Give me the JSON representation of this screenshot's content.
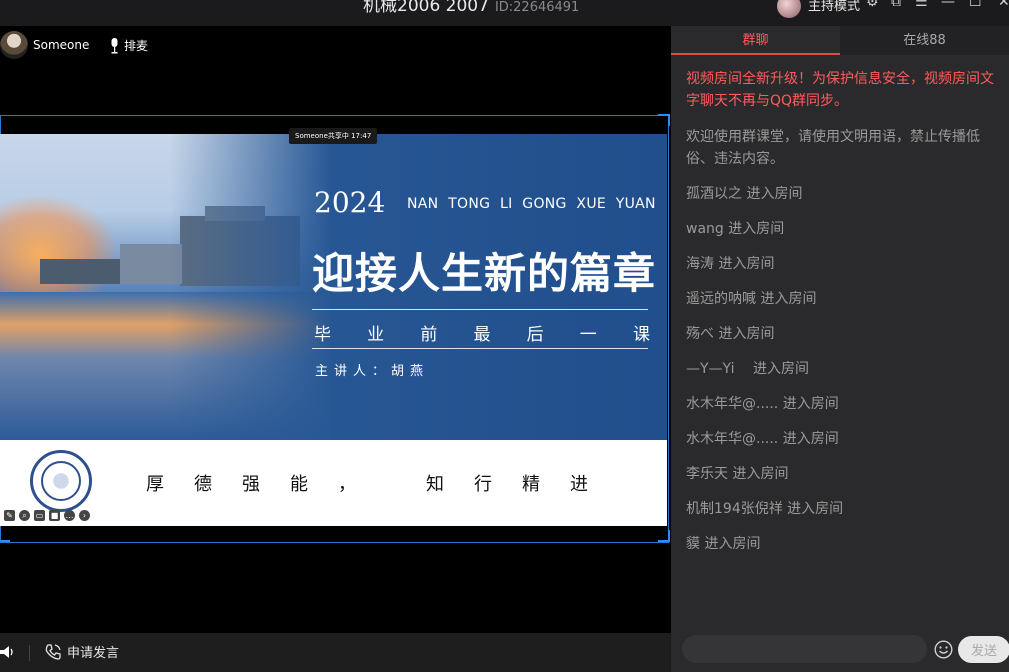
{
  "window": {
    "title": "机械2006 2007",
    "room_id": "ID:22646491",
    "host_mode_label": "主持模式"
  },
  "presenter": {
    "name": "Someone",
    "mic_label": "排麦",
    "share_tag": "Someone共享中 17:47"
  },
  "slide": {
    "year": "2024",
    "school_en": "NAN TONG LI GONG XUE YUAN",
    "headline": "迎接人生新的篇章",
    "subtitle_chars": [
      "毕",
      "业",
      "前",
      "最",
      "后",
      "一",
      "课"
    ],
    "lecturer": "主讲人：胡燕",
    "motto_left": [
      "厚",
      "德",
      "强",
      "能",
      "，"
    ],
    "motto_right": [
      "知",
      "行",
      "精",
      "进"
    ]
  },
  "bottombar": {
    "apply_label": "申请发言"
  },
  "chat": {
    "tabs": [
      {
        "label": "群聊",
        "active": true
      },
      {
        "label": "在线88",
        "active": false
      }
    ],
    "notice": "视频房间全新升级！为保护信息安全，视频房间文字聊天不再与QQ群同步。",
    "welcome": "欢迎使用群课堂，请使用文明用语，禁止传播低俗、违法内容。",
    "entries": [
      {
        "text": "孤酒以之 进入房间"
      },
      {
        "text": "wang 进入房间"
      },
      {
        "text": "海涛 进入房间"
      },
      {
        "text": "遥远的呐喊 进入房间"
      },
      {
        "text": "殇べ 进入房间"
      },
      {
        "text": "—Y—Yi　 进入房间"
      },
      {
        "text": "水木年华@..... 进入房间"
      },
      {
        "text": "水木年华@..... 进入房间"
      },
      {
        "text": "李乐天 进入房间"
      },
      {
        "text": "机制194张倪祥 进入房间"
      },
      {
        "text": "貘 进入房间"
      }
    ],
    "input_placeholder": "",
    "send_label": "发送"
  },
  "colors": {
    "accent_red": "#ff5c5c",
    "frame_blue": "#2a78d0",
    "slide_blue": "#285895"
  }
}
